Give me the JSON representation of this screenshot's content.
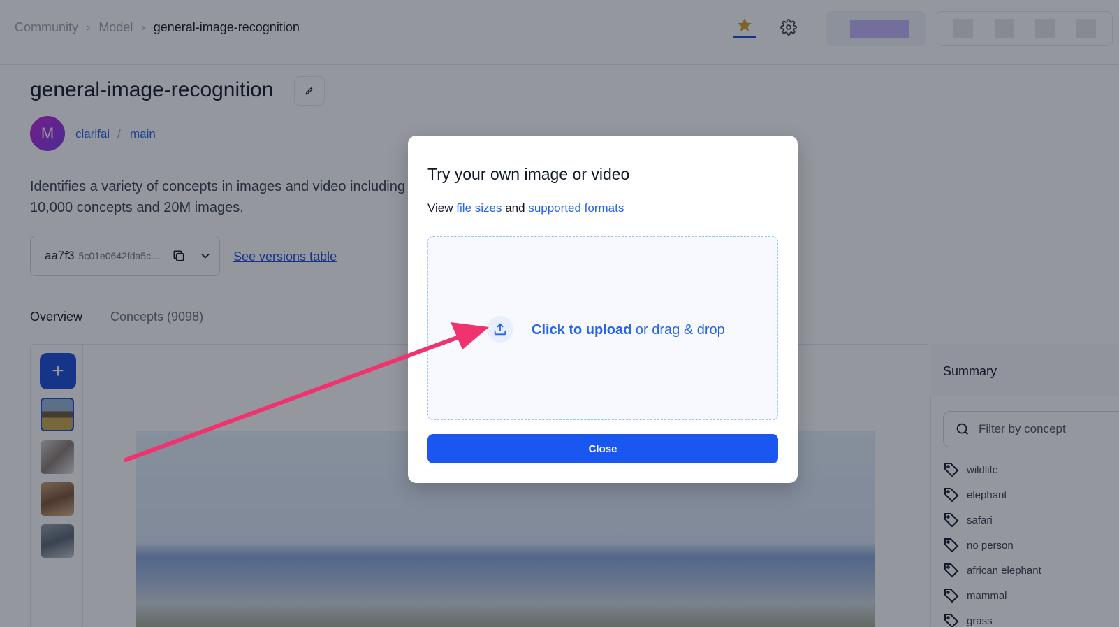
{
  "breadcrumb": {
    "items": [
      "Community",
      "Model",
      "general-image-recognition"
    ],
    "separator": ">"
  },
  "header": {
    "icons": [
      "star-icon",
      "gear-icon"
    ],
    "accent_color": "#d69e2e"
  },
  "model": {
    "title": "general-image-recognition",
    "avatar_letter": "M",
    "owner": "clarifai",
    "owner_separator": "/",
    "branch": "main",
    "description": "Identifies a variety of concepts in images and video including\n10,000 concepts and 20M images."
  },
  "version": {
    "short": "aa7f3",
    "hash": "5c01e0642fda5c...",
    "see_versions_label": "See versions table"
  },
  "tabs": [
    {
      "label": "Overview",
      "active": true
    },
    {
      "label": "Concepts (9098)",
      "active": false
    }
  ],
  "workspace": {
    "add_label": "+"
  },
  "summary": {
    "title": "Summary",
    "filter_placeholder": "Filter by concept",
    "concepts": [
      "wildlife",
      "elephant",
      "safari",
      "no person",
      "african elephant",
      "mammal",
      "grass"
    ]
  },
  "modal": {
    "title": "Try your own image or video",
    "view_prefix": "View",
    "file_sizes_link": "file sizes",
    "and_text": "and",
    "formats_link": "supported formats",
    "upload_strong": "Click to upload",
    "upload_rest": "or drag & drop",
    "close_label": "Close",
    "primary_color": "#1a56f0"
  },
  "annotation": {
    "arrow_color": "#f0326e"
  }
}
